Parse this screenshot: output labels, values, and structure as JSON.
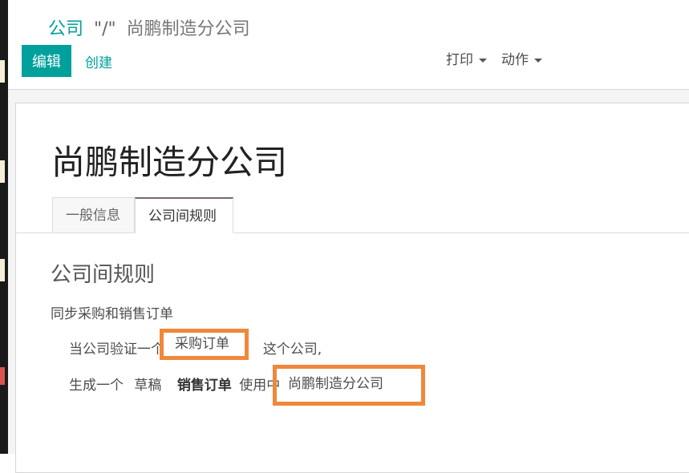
{
  "breadcrumb": {
    "parent": "公司",
    "separator": "\"/\"",
    "current": "尚鹏制造分公司"
  },
  "toolbar": {
    "edit_label": "编辑",
    "create_label": "创建",
    "print_label": "打印",
    "action_label": "动作"
  },
  "record": {
    "title": "尚鹏制造分公司"
  },
  "tabs": [
    {
      "label": "一般信息",
      "active": false
    },
    {
      "label": "公司间规则",
      "active": true
    }
  ],
  "intercompany": {
    "section_title": "公司间规则",
    "sync_label": "同步采购和销售订单",
    "rule1_prefix": "当公司验证一个",
    "rule1_field": "采购订单",
    "rule1_suffix": "这个公司,",
    "rule2_prefix": "生成一个",
    "rule2_state": "草稿",
    "rule2_doc": "销售订单",
    "rule2_mid": "使用中",
    "rule2_field": "尚鹏制造分公司"
  },
  "colors": {
    "accent": "#00a09d",
    "highlight": "#f0883a",
    "active_tab_border": "#7c6576"
  }
}
